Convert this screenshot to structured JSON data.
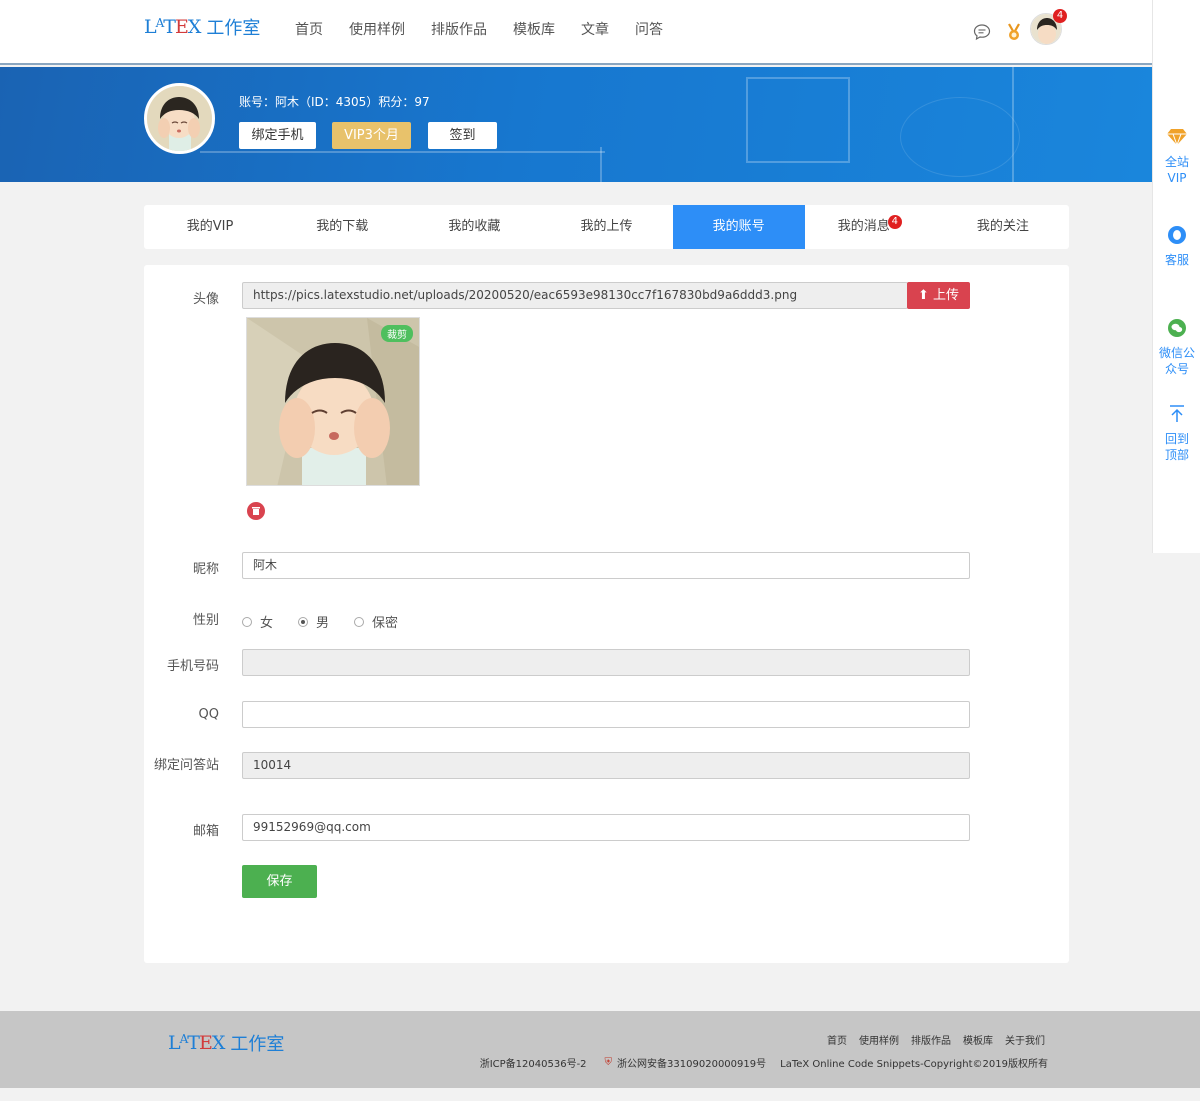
{
  "header": {
    "logo_text": "LATEX",
    "logo_studio": "工作室",
    "nav": [
      "首页",
      "使用样例",
      "排版作品",
      "模板库",
      "文章",
      "问答"
    ],
    "notification_count": "4"
  },
  "profile": {
    "account_line": "账号：阿木（ID：4305）积分：97",
    "bind_phone": "绑定手机",
    "vip_btn": "VIP3个月",
    "checkin": "签到"
  },
  "tabs": [
    {
      "label": "我的VIP"
    },
    {
      "label": "我的下载"
    },
    {
      "label": "我的收藏"
    },
    {
      "label": "我的上传"
    },
    {
      "label": "我的账号",
      "active": true
    },
    {
      "label": "我的消息",
      "badge": "4"
    },
    {
      "label": "我的关注"
    }
  ],
  "form": {
    "avatar_label": "头像",
    "avatar_url": "https://pics.latexstudio.net/uploads/20200520/eac6593e98130cc7f167830bd9a6ddd3.png",
    "upload_btn": "上传",
    "crop_label": "裁剪",
    "nickname_label": "昵称",
    "nickname": "阿木",
    "gender_label": "性别",
    "gender_options": [
      "女",
      "男",
      "保密"
    ],
    "gender_selected": "男",
    "phone_label": "手机号码",
    "phone": "",
    "qq_label": "QQ",
    "qq": "",
    "qa_label": "绑定问答站",
    "qa_value": "10014",
    "email_label": "邮箱",
    "email": "99152969@qq.com",
    "save_btn": "保存"
  },
  "sidebar": {
    "vip": "全站VIP",
    "service": "客服",
    "wechat": "微信公众号",
    "top": "回到顶部"
  },
  "footer": {
    "links": [
      "首页",
      "使用样例",
      "排版作品",
      "模板库",
      "关于我们"
    ],
    "icp": "浙ICP备12040536号-2",
    "police": "浙公网安备33109020000919号",
    "copyright": "LaTeX Online Code Snippets-Copyright©2019版权所有"
  },
  "colors": {
    "primary": "#2d8ef7",
    "danger": "#d9434f",
    "success": "#4cb050",
    "vip": "#e8c26b"
  }
}
